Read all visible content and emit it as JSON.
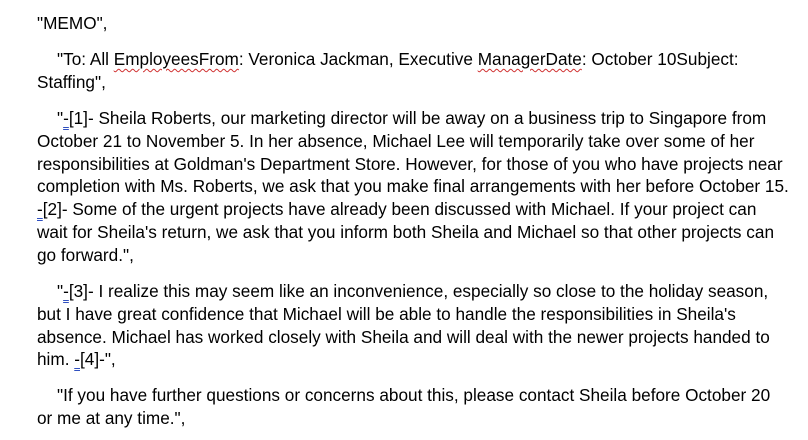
{
  "memo": {
    "title_line": "\"MEMO\",",
    "header": {
      "open": "\"To: All ",
      "to_word": "EmployeesFrom",
      "mid": ": Veronica Jackman, Executive ",
      "from_word": "ManagerDate",
      "rest": ": October 10Subject: Staffing\","
    },
    "body1": {
      "open": "\"",
      "m1": "-",
      "s1": "[1]- Sheila Roberts, our marketing director will be away on a business trip to Singapore from October 21 to November 5. In her absence, Michael Lee will temporarily take over some of her responsibilities at Goldman's Department Store. However, for those of you who have projects near completion with Ms. Roberts, we ask that you make final arrangements with her before October 15. ",
      "m2": "-",
      "s2": "[2]- Some of the urgent projects have already been discussed with Michael. If your project can wait for Sheila's return, we ask that you inform both Sheila and Michael so that other projects can go forward.\","
    },
    "body2": {
      "open": "\"",
      "m3": "-",
      "s3": "[3]- I realize this may seem like an inconvenience, especially so close to the holiday season, but I have great confidence that Michael will be able to handle the responsibilities in Sheila's absence. Michael has worked closely with Sheila and will deal with the newer projects handed to him. ",
      "m4": "-",
      "s4": "[4]-\","
    },
    "closing": "\"If you have further questions or concerns about this, please contact Sheila before October 20 or me at any time.\","
  },
  "colors": {
    "spelling_underline": "#d03030",
    "marker_underline": "#3050c0",
    "text": "#000000",
    "background": "#ffffff"
  }
}
